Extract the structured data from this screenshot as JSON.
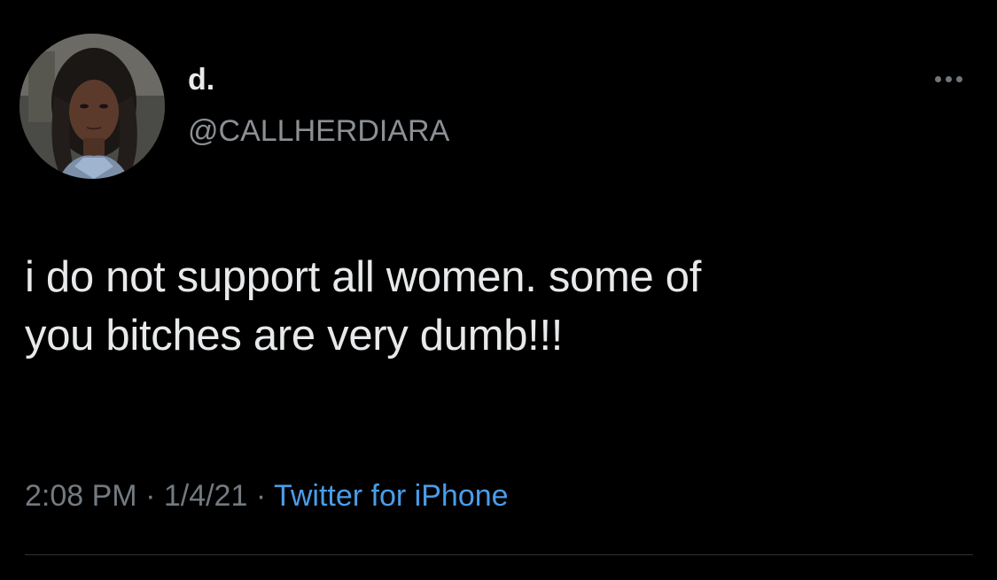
{
  "tweet": {
    "author": {
      "display_name": "d.",
      "handle": "@CALLHERDIARA"
    },
    "more_menu_icon": "more-horizontal-icon",
    "text": "i do not support all women. some of\nyou bitches are very dumb!!!",
    "meta": {
      "time": "2:08 PM",
      "separator_1": " · ",
      "date": "1/4/21",
      "separator_2": " · ",
      "source": "Twitter for iPhone"
    }
  },
  "colors": {
    "background": "#000000",
    "primary_text": "#e7e9ea",
    "secondary_text": "#8b9095",
    "link": "#4a9de8",
    "divider": "#2f3336"
  }
}
